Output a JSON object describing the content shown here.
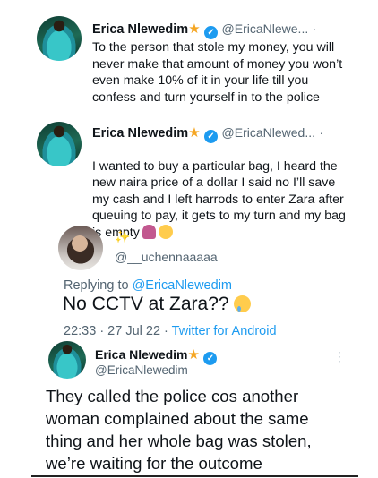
{
  "tweet1": {
    "name": "Erica Nlewedim",
    "handle": "@EricaNlewe...",
    "dot": "·",
    "text": "To the person that stole my money, you will\nnever make that amount of money you won’t\neven make 10% of it in your life till you\nconfess and turn yourself in to the police"
  },
  "tweet2": {
    "name": "Erica Nlewedim",
    "handle": "@EricaNlewed...",
    "dot": "·",
    "text": "I wanted to buy a particular bag, I heard the\nnew naira price of a dollar I said no I’ll save\nmy cash and I left harrods to enter Zara after\nqueuing to pay, it gets to my turn and my bag\nis empty"
  },
  "reply": {
    "sparkle": "✨",
    "handle": "@__uchennaaaaa",
    "replying_label": "Replying to ",
    "replying_to": "@EricaNlewedim",
    "text": "No CCTV at Zara??",
    "time": "22:33 · 27 Jul 22 · ",
    "source": "Twitter for Android"
  },
  "tweet3": {
    "name": "Erica Nlewedim",
    "handle": "@EricaNlewedim",
    "more": "⋮",
    "text": "They called the police cos another\nwoman complained about the same\nthing and her whole bag was stolen,\nwe’re waiting for the outcome"
  },
  "icons": {
    "star": "★",
    "verified": "✓"
  },
  "colors": {
    "link": "#1d9bf0",
    "muted": "#536471",
    "star": "#f5a623"
  }
}
